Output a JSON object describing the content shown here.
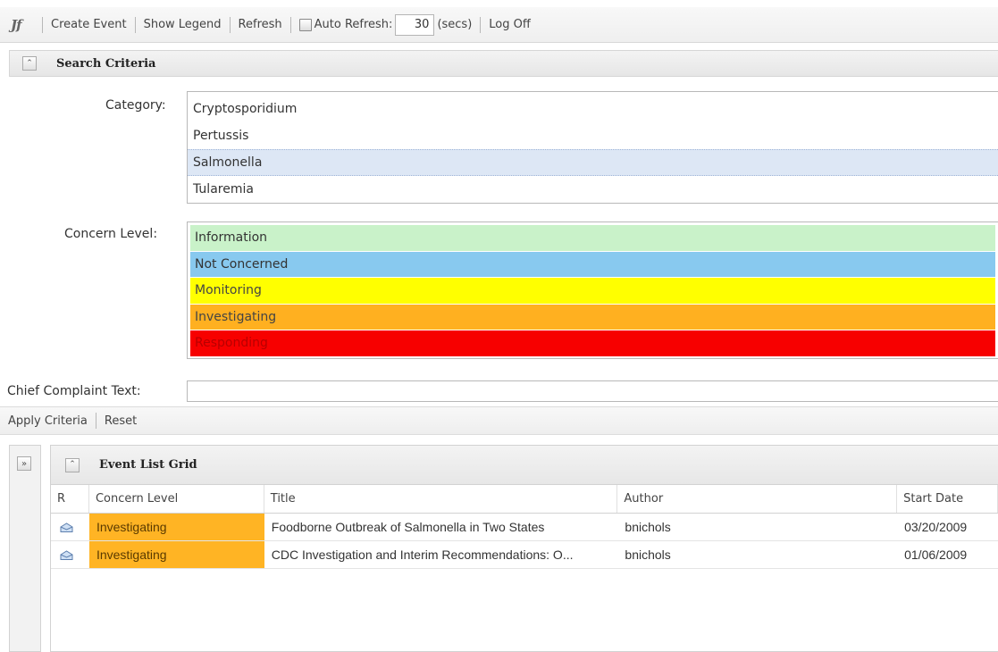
{
  "toolbar": {
    "logo_text": "Jf",
    "create_event": "Create Event",
    "show_legend": "Show Legend",
    "refresh": "Refresh",
    "auto_refresh_label": "Auto Refresh:",
    "auto_refresh_checked": false,
    "interval_value": "30",
    "interval_unit": "(secs)",
    "log_off": "Log Off"
  },
  "search": {
    "header_title": "Search Criteria",
    "category_label": "Category:",
    "categories": [
      "Cryptosporidium",
      "Pertussis",
      "Salmonella",
      "Tularemia"
    ],
    "selected_category": "Salmonella",
    "concern_label": "Concern Level:",
    "concern_levels": [
      {
        "label": "Information",
        "color": "#c9f2c9",
        "text_color": "#333333"
      },
      {
        "label": "Not Concerned",
        "color": "#88c9ef",
        "text_color": "#333333"
      },
      {
        "label": "Monitoring",
        "color": "#ffff00",
        "text_color": "#444444"
      },
      {
        "label": "Investigating",
        "color": "#ffb020",
        "text_color": "#444444"
      },
      {
        "label": "Responding",
        "color": "#f70000",
        "text_color": "#b80000"
      }
    ],
    "complaint_label": "Chief Complaint Text:",
    "complaint_value": ""
  },
  "actions": {
    "apply": "Apply Criteria",
    "reset": "Reset"
  },
  "grid": {
    "title": "Event List Grid",
    "columns": [
      "R",
      "Concern Level",
      "Title",
      "Author",
      "Start Date"
    ],
    "rows": [
      {
        "icon": "envelope-icon",
        "level": "Investigating",
        "title": "Foodborne Outbreak of Salmonella in Two States",
        "author": "bnichols",
        "start_date": "03/20/2009"
      },
      {
        "icon": "envelope-icon",
        "level": "Investigating",
        "title": "CDC Investigation and Interim Recommendations: O...",
        "author": "bnichols",
        "start_date": "01/06/2009"
      }
    ]
  },
  "colors": {
    "investigating": "#ffb424",
    "selection": "#dde7f5"
  }
}
